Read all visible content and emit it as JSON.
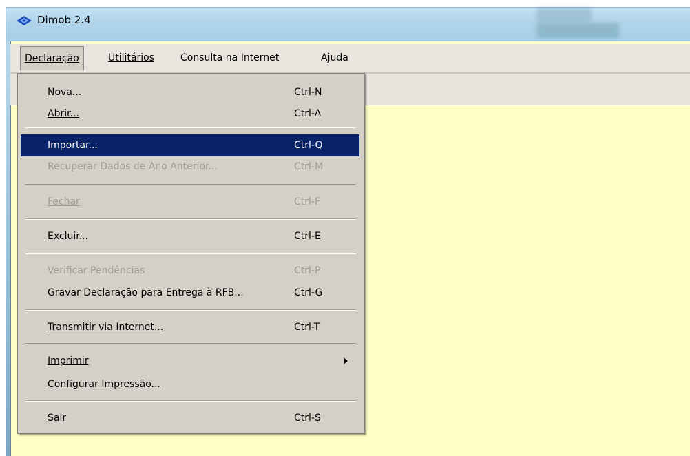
{
  "window": {
    "title": "Dimob 2.4",
    "icon": "dimob-app-icon"
  },
  "menubar": {
    "items": [
      {
        "label": "Declaração",
        "open": true
      },
      {
        "label": "Utilitários"
      },
      {
        "label": "Consulta na Internet"
      },
      {
        "label": "Ajuda"
      }
    ]
  },
  "dropdown": {
    "items": [
      {
        "label": "Nova...",
        "shortcut": "Ctrl-N"
      },
      {
        "label": "Abrir...",
        "shortcut": "Ctrl-A"
      },
      {
        "label": "Importar...",
        "shortcut": "Ctrl-Q",
        "highlighted": true
      },
      {
        "label": "Recuperar Dados de Ano Anterior...",
        "shortcut": "Ctrl-M",
        "disabled": true
      },
      {
        "label": "Fechar",
        "shortcut": "Ctrl-F",
        "disabled": true
      },
      {
        "label": "Excluir...",
        "shortcut": "Ctrl-E"
      },
      {
        "label": "Verificar Pendências",
        "shortcut": "Ctrl-P",
        "disabled": true
      },
      {
        "label": "Gravar Declaração para Entrega à RFB...",
        "shortcut": "Ctrl-G"
      },
      {
        "label": "Transmitir via Internet...",
        "shortcut": "Ctrl-T"
      },
      {
        "label": "Imprimir",
        "submenu": true
      },
      {
        "label": "Configurar Impressão..."
      },
      {
        "label": "Sair",
        "shortcut": "Ctrl-S"
      }
    ]
  },
  "colors": {
    "client_background": "#ffffc6",
    "menu_background": "#d4d0c8",
    "highlight": "#0a246a"
  }
}
